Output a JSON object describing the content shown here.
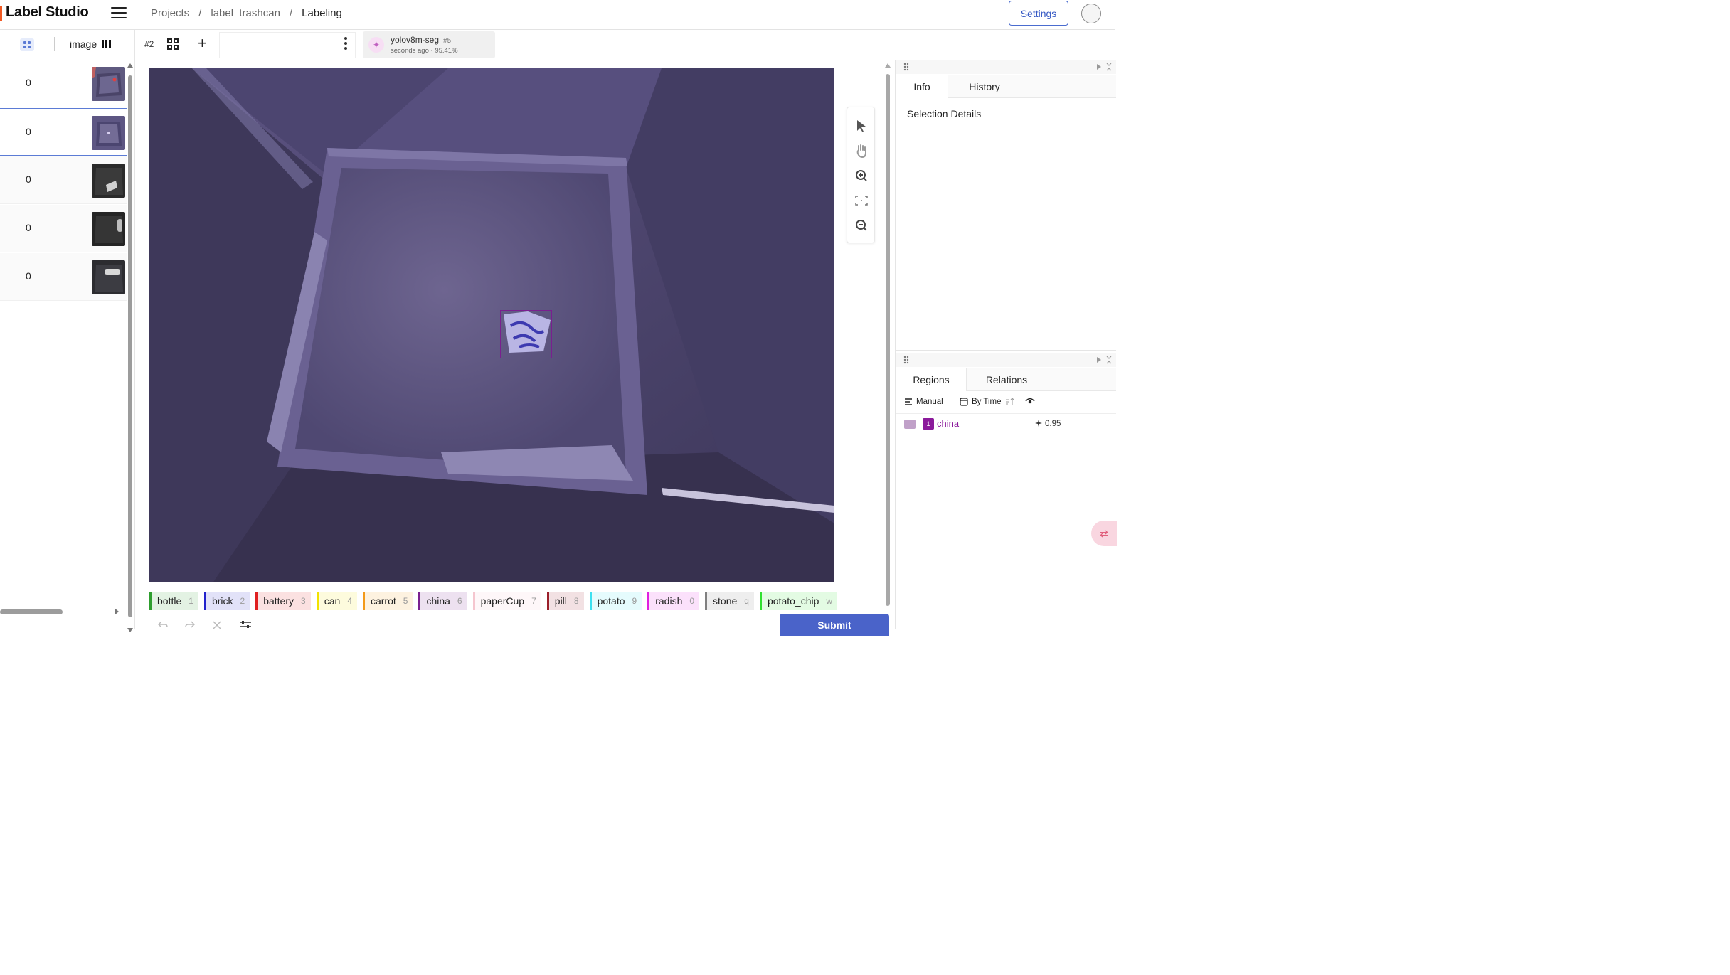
{
  "app": {
    "title": "Label Studio"
  },
  "breadcrumb": {
    "items": [
      "Projects",
      "label_trashcan",
      "Labeling"
    ],
    "separator": "/"
  },
  "header": {
    "settings_label": "Settings"
  },
  "sidebar": {
    "column_label": "image",
    "rows": [
      {
        "count": "0"
      },
      {
        "count": "0"
      },
      {
        "count": "0"
      },
      {
        "count": "0"
      },
      {
        "count": "0"
      }
    ]
  },
  "annotation_tabs": {
    "task_number": "#2",
    "prediction": {
      "model": "yolov8m-seg",
      "id": "#5",
      "meta": "seconds ago · 95.41%"
    }
  },
  "labels": [
    {
      "name": "bottle",
      "hotkey": "1",
      "color": "#2e9e2e"
    },
    {
      "name": "brick",
      "hotkey": "2",
      "color": "#2222cc"
    },
    {
      "name": "battery",
      "hotkey": "3",
      "color": "#e02020"
    },
    {
      "name": "can",
      "hotkey": "4",
      "color": "#f2e200"
    },
    {
      "name": "carrot",
      "hotkey": "5",
      "color": "#f39a1a"
    },
    {
      "name": "china",
      "hotkey": "6",
      "color": "#7a1f8f"
    },
    {
      "name": "paperCup",
      "hotkey": "7",
      "color": "#f5c6cf"
    },
    {
      "name": "pill",
      "hotkey": "8",
      "color": "#9a1f2a"
    },
    {
      "name": "potato",
      "hotkey": "9",
      "color": "#3de0f0"
    },
    {
      "name": "radish",
      "hotkey": "0",
      "color": "#e020e0"
    },
    {
      "name": "stone",
      "hotkey": "q",
      "color": "#808080"
    },
    {
      "name": "potato_chip",
      "hotkey": "w",
      "color": "#30e030"
    }
  ],
  "actions": {
    "submit_label": "Submit"
  },
  "right_panel": {
    "tabs_top": [
      "Info",
      "History"
    ],
    "selection_details": "Selection Details",
    "tabs_bottom": [
      "Regions",
      "Relations"
    ],
    "tools": {
      "order_label": "Manual",
      "sort_label": "By Time"
    },
    "regions": [
      {
        "index": "1",
        "label": "china",
        "score": "0.95"
      }
    ]
  }
}
